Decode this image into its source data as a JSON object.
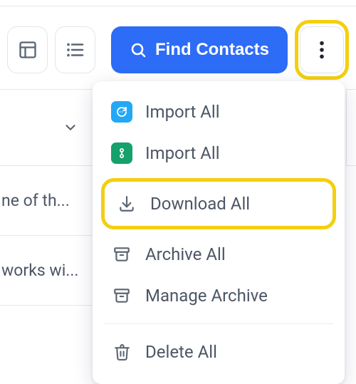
{
  "toolbar": {
    "find_contacts_label": "Find Contacts"
  },
  "left_column": {
    "rows": [
      "ne of th...",
      "works wi..."
    ]
  },
  "menu": {
    "items": [
      {
        "label": "Import All",
        "icon": "chat-app"
      },
      {
        "label": "Import All",
        "icon": "link-app"
      },
      {
        "label": "Download All",
        "icon": "download",
        "highlight": true
      },
      {
        "label": "Archive All",
        "icon": "archive"
      },
      {
        "label": "Manage Archive",
        "icon": "archive"
      },
      {
        "separator": true
      },
      {
        "label": "Delete All",
        "icon": "trash"
      }
    ]
  }
}
